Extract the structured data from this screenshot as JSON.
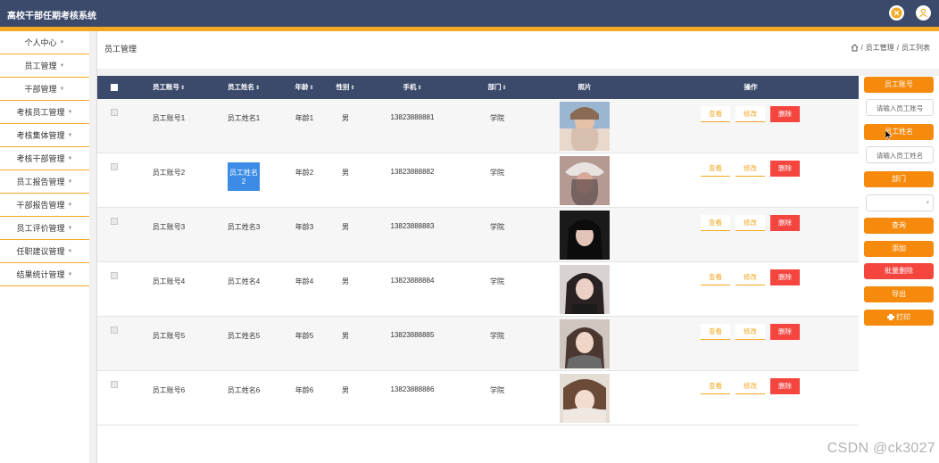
{
  "app": {
    "title": "高校干部任期考核系统"
  },
  "colors": {
    "header": "#3b4a6b",
    "accent": "#f3a722",
    "button": "#f58a0c",
    "danger": "#f5453f",
    "selection": "#3c8ce7"
  },
  "header_icons": {
    "close": "close-circle-icon",
    "user": "user-icon"
  },
  "sidebar": {
    "items": [
      {
        "label": "个人中心"
      },
      {
        "label": "员工管理"
      },
      {
        "label": "干部管理"
      },
      {
        "label": "考核员工管理"
      },
      {
        "label": "考核集体管理"
      },
      {
        "label": "考核干部管理"
      },
      {
        "label": "员工报告管理"
      },
      {
        "label": "干部报告管理"
      },
      {
        "label": "员工评价管理"
      },
      {
        "label": "任职建议管理"
      },
      {
        "label": "结果统计管理"
      }
    ]
  },
  "page": {
    "title": "员工管理",
    "breadcrumb": {
      "home_icon": "home-icon",
      "sep": "/",
      "level1": "员工管理",
      "level2": "员工列表"
    }
  },
  "table": {
    "headers": [
      "员工账号",
      "员工姓名",
      "年龄",
      "性别",
      "手机",
      "部门",
      "照片",
      "操作"
    ],
    "sort_marker": "⇕",
    "rows": [
      {
        "account": "员工账号1",
        "name": "员工姓名1",
        "age": "年龄1",
        "gender": "男",
        "phone": "13823888881",
        "dept": "学院"
      },
      {
        "account": "员工账号2",
        "name": "员工姓名2",
        "age": "年龄2",
        "gender": "男",
        "phone": "13823888882",
        "dept": "学院"
      },
      {
        "account": "员工账号3",
        "name": "员工姓名3",
        "age": "年龄3",
        "gender": "男",
        "phone": "13823888883",
        "dept": "学院"
      },
      {
        "account": "员工账号4",
        "name": "员工姓名4",
        "age": "年龄4",
        "gender": "男",
        "phone": "13823888884",
        "dept": "学院"
      },
      {
        "account": "员工账号5",
        "name": "员工姓名5",
        "age": "年龄5",
        "gender": "男",
        "phone": "13823888885",
        "dept": "学院"
      },
      {
        "account": "员工账号6",
        "name": "员工姓名6",
        "age": "年龄6",
        "gender": "男",
        "phone": "13823888886",
        "dept": "学院"
      }
    ],
    "actions": {
      "view": "查看",
      "edit": "修改",
      "delete": "删除"
    }
  },
  "search_panel": {
    "account_label": "员工账号",
    "account_placeholder": "请输入员工账号",
    "name_label": "员工姓名",
    "name_placeholder": "请输入员工姓名",
    "dept_label": "部门",
    "dept_value": "",
    "query_button": "查询",
    "add_button": "添加",
    "batch_delete_button": "批量删除",
    "export_button": "导出",
    "print_button": "打印"
  },
  "watermark": "CSDN @ck3027"
}
